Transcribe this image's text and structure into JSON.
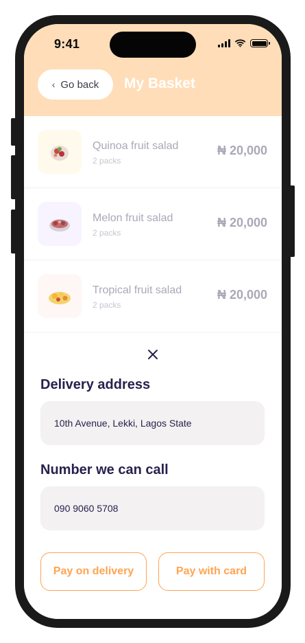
{
  "status_bar": {
    "time": "9:41"
  },
  "header": {
    "back_label": "Go back",
    "title": "My Basket",
    "background_color": "#FFDDB8"
  },
  "basket": {
    "items": [
      {
        "name": "Quinoa fruit salad",
        "quantity": "2 packs",
        "price": "₦ 20,000",
        "thumb_color": "#FFFAEB",
        "icon": "quinoa-salad-icon"
      },
      {
        "name": "Melon fruit salad",
        "quantity": "2 packs",
        "price": "₦ 20,000",
        "thumb_color": "#F8F4FF",
        "icon": "melon-salad-icon"
      },
      {
        "name": "Tropical fruit salad",
        "quantity": "2 packs",
        "price": "₦ 20,000",
        "thumb_color": "#FFF6F6",
        "icon": "tropical-salad-icon"
      }
    ]
  },
  "checkout": {
    "close_icon": "close-icon",
    "delivery_label": "Delivery address",
    "delivery_value": "10th Avenue, Lekki, Lagos State",
    "phone_label": "Number we can call",
    "phone_value": "090 9060 5708",
    "pay_delivery_label": "Pay on delivery",
    "pay_card_label": "Pay with card",
    "accent_color": "#FFA451"
  }
}
